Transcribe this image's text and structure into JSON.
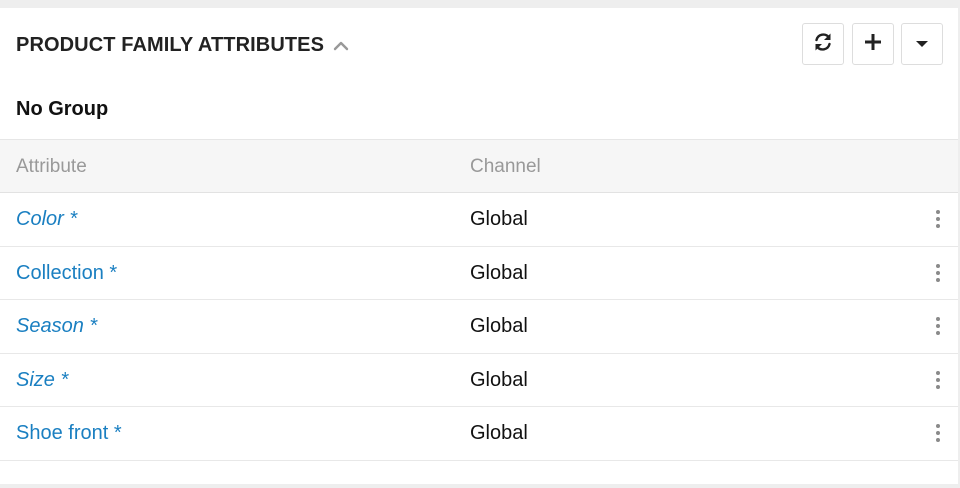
{
  "panel": {
    "title": "PRODUCT FAMILY ATTRIBUTES",
    "toggle_icon": "chevron-up-icon",
    "actions": [
      {
        "name": "refresh-button",
        "icon": "refresh-icon"
      },
      {
        "name": "add-button",
        "icon": "plus-icon"
      },
      {
        "name": "dropdown-button",
        "icon": "caret-down-icon"
      }
    ]
  },
  "group": {
    "title": "No Group"
  },
  "table": {
    "columns": [
      "Attribute",
      "Channel"
    ],
    "rows": [
      {
        "attribute": "Color *",
        "channel": "Global",
        "italic": true
      },
      {
        "attribute": "Collection *",
        "channel": "Global",
        "italic": false
      },
      {
        "attribute": "Season *",
        "channel": "Global",
        "italic": true
      },
      {
        "attribute": "Size *",
        "channel": "Global",
        "italic": true
      },
      {
        "attribute": "Shoe front *",
        "channel": "Global",
        "italic": false
      }
    ],
    "row_menu_icon": "kebab-icon"
  },
  "colors": {
    "link": "#1a7fc1",
    "header_bg": "#f6f6f6",
    "muted": "#999999"
  }
}
